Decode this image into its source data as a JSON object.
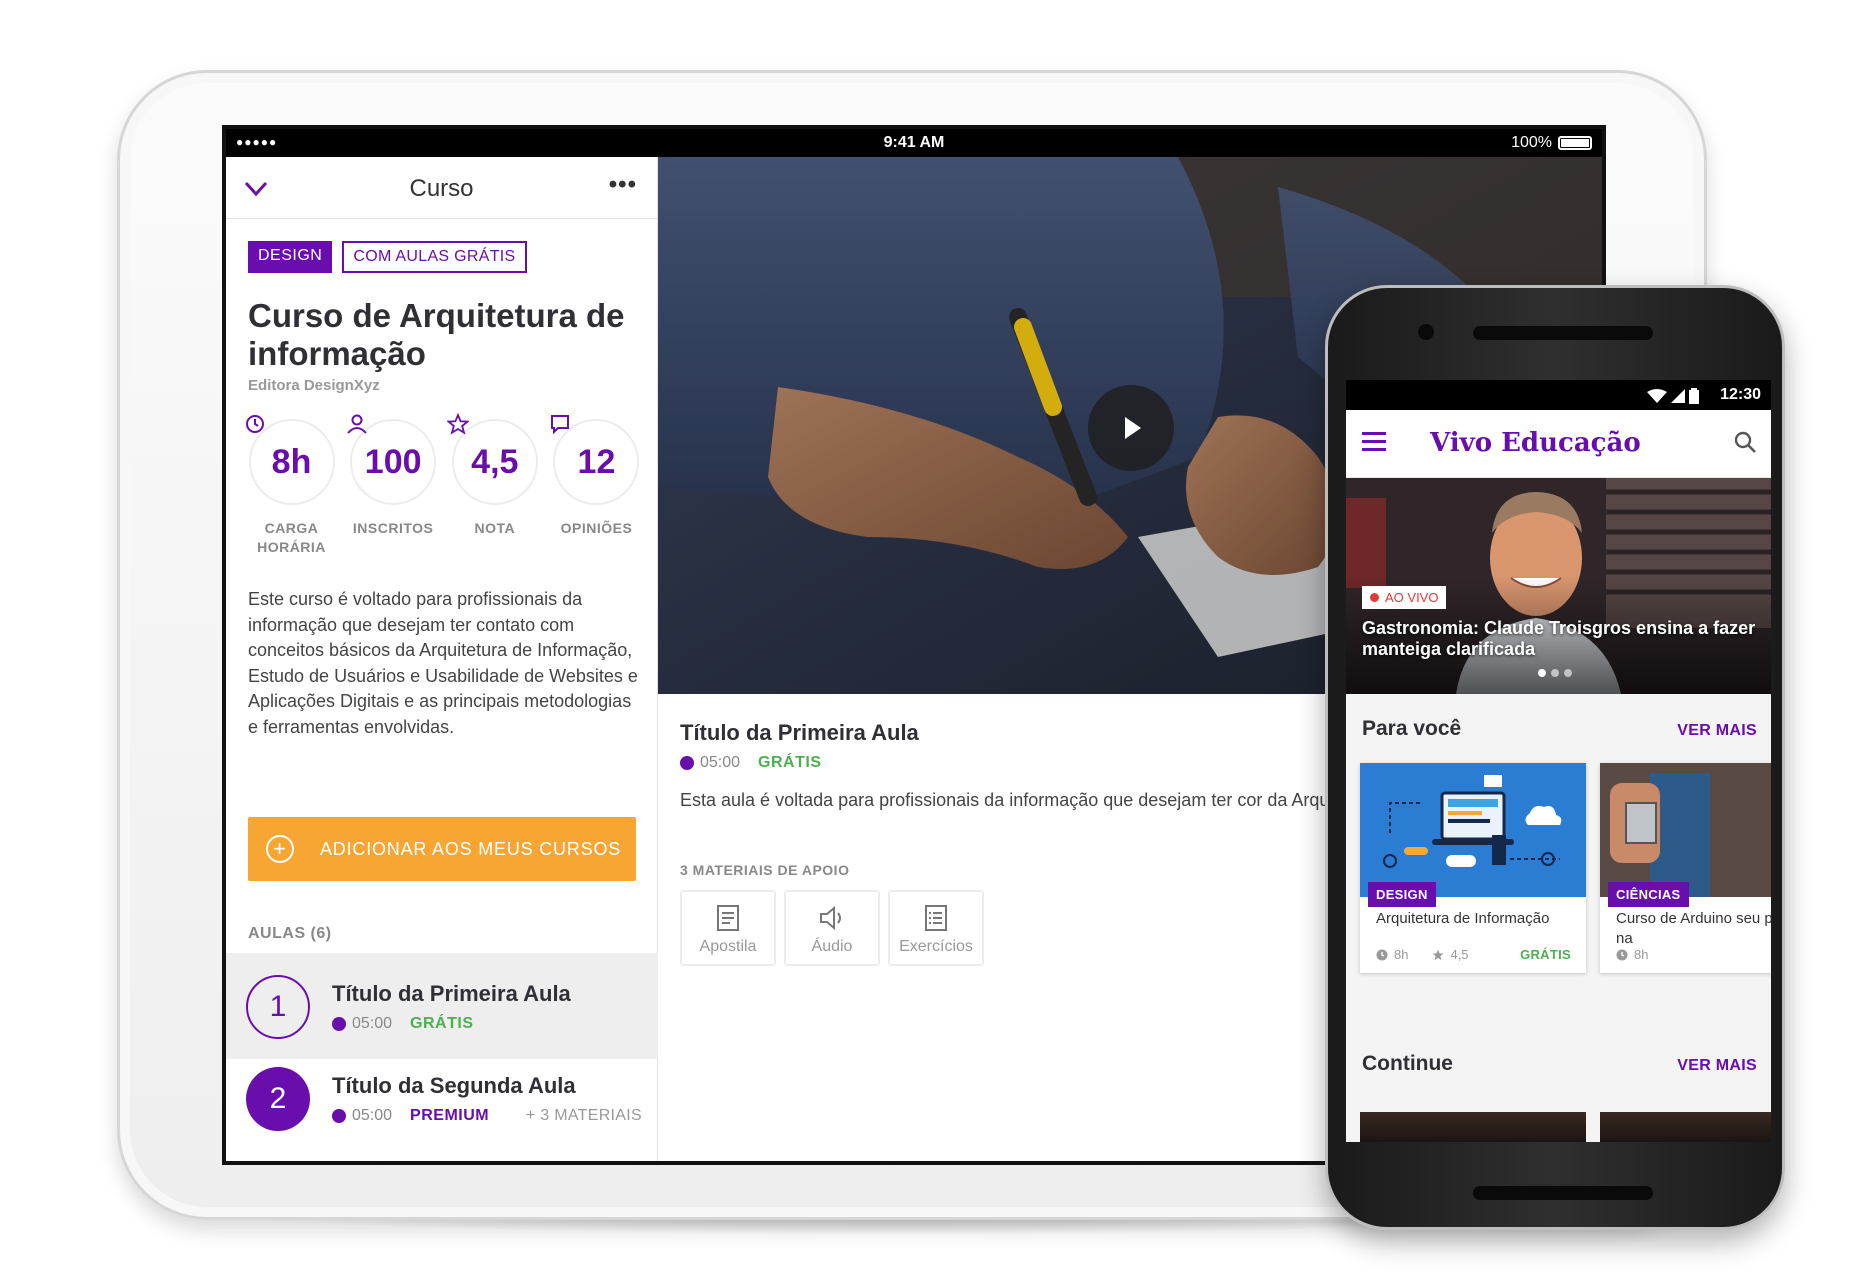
{
  "tablet": {
    "statusbar": {
      "signal": "●●●●●",
      "time": "9:41 AM",
      "battery": "100%"
    },
    "header": {
      "title": "Curso",
      "more": "•••"
    },
    "tags": {
      "category": "DESIGN",
      "free_lessons": "COM AULAS GRÁTIS"
    },
    "course": {
      "title": "Curso de Arquitetura de informação",
      "publisher": "Editora DesignXyz",
      "description": "Este curso é voltado para profissionais da informação que desejam ter contato com conceitos básicos da Arquitetura de Informação, Estudo de Usuários e Usabilidade de Websites e Aplicações Digitais e as principais metodologias e ferramentas envolvidas."
    },
    "stats": [
      {
        "value": "8h",
        "label": "CARGA HORÁRIA",
        "icon": "clock-icon"
      },
      {
        "value": "100",
        "label": "INSCRITOS",
        "icon": "user-icon"
      },
      {
        "value": "4,5",
        "label": "NOTA",
        "icon": "star-icon"
      },
      {
        "value": "12",
        "label": "OPINIÕES",
        "icon": "comment-icon"
      }
    ],
    "add_button": "ADICIONAR AOS MEUS CURSOS",
    "lessons_label": "AULAS (6)",
    "lessons": [
      {
        "number": "1",
        "title": "Título da Primeira Aula",
        "duration": "05:00",
        "access": "GRÁTIS",
        "extra": ""
      },
      {
        "number": "2",
        "title": "Título da Segunda Aula",
        "duration": "05:00",
        "access": "PREMIUM",
        "extra": "+ 3 MATERIAIS"
      }
    ],
    "current_lesson": {
      "title": "Título da Primeira Aula",
      "duration": "05:00",
      "access": "GRÁTIS",
      "description": "Esta aula é voltada para profissionais da informação que desejam ter cor da Arquitetura de Informação.",
      "materials_label": "3 MATERIAIS DE APOIO",
      "materials": [
        {
          "label": "Apostila",
          "icon": "document-icon"
        },
        {
          "label": "Áudio",
          "icon": "speaker-icon"
        },
        {
          "label": "Exercícios",
          "icon": "list-icon"
        }
      ]
    }
  },
  "phone": {
    "statusbar": {
      "time": "12:30"
    },
    "appbar": {
      "title": "Vivo Educação"
    },
    "hero": {
      "badge": "AO VIVO",
      "title": "Gastronomia: Claude Troisgros ensina a fazer manteiga clarificada"
    },
    "for_you": {
      "title": "Para você",
      "see_more": "VER MAIS",
      "cards": [
        {
          "tag": "DESIGN",
          "title": "Arquitetura de Informação",
          "hours": "8h",
          "rating": "4,5",
          "access": "GRÁTIS"
        },
        {
          "tag": "CIÊNCIAS",
          "title": "Curso de Arduino seu projeto na",
          "hours": "8h",
          "rating": "",
          "access": ""
        }
      ]
    },
    "continue": {
      "title": "Continue",
      "see_more": "VER MAIS"
    }
  }
}
